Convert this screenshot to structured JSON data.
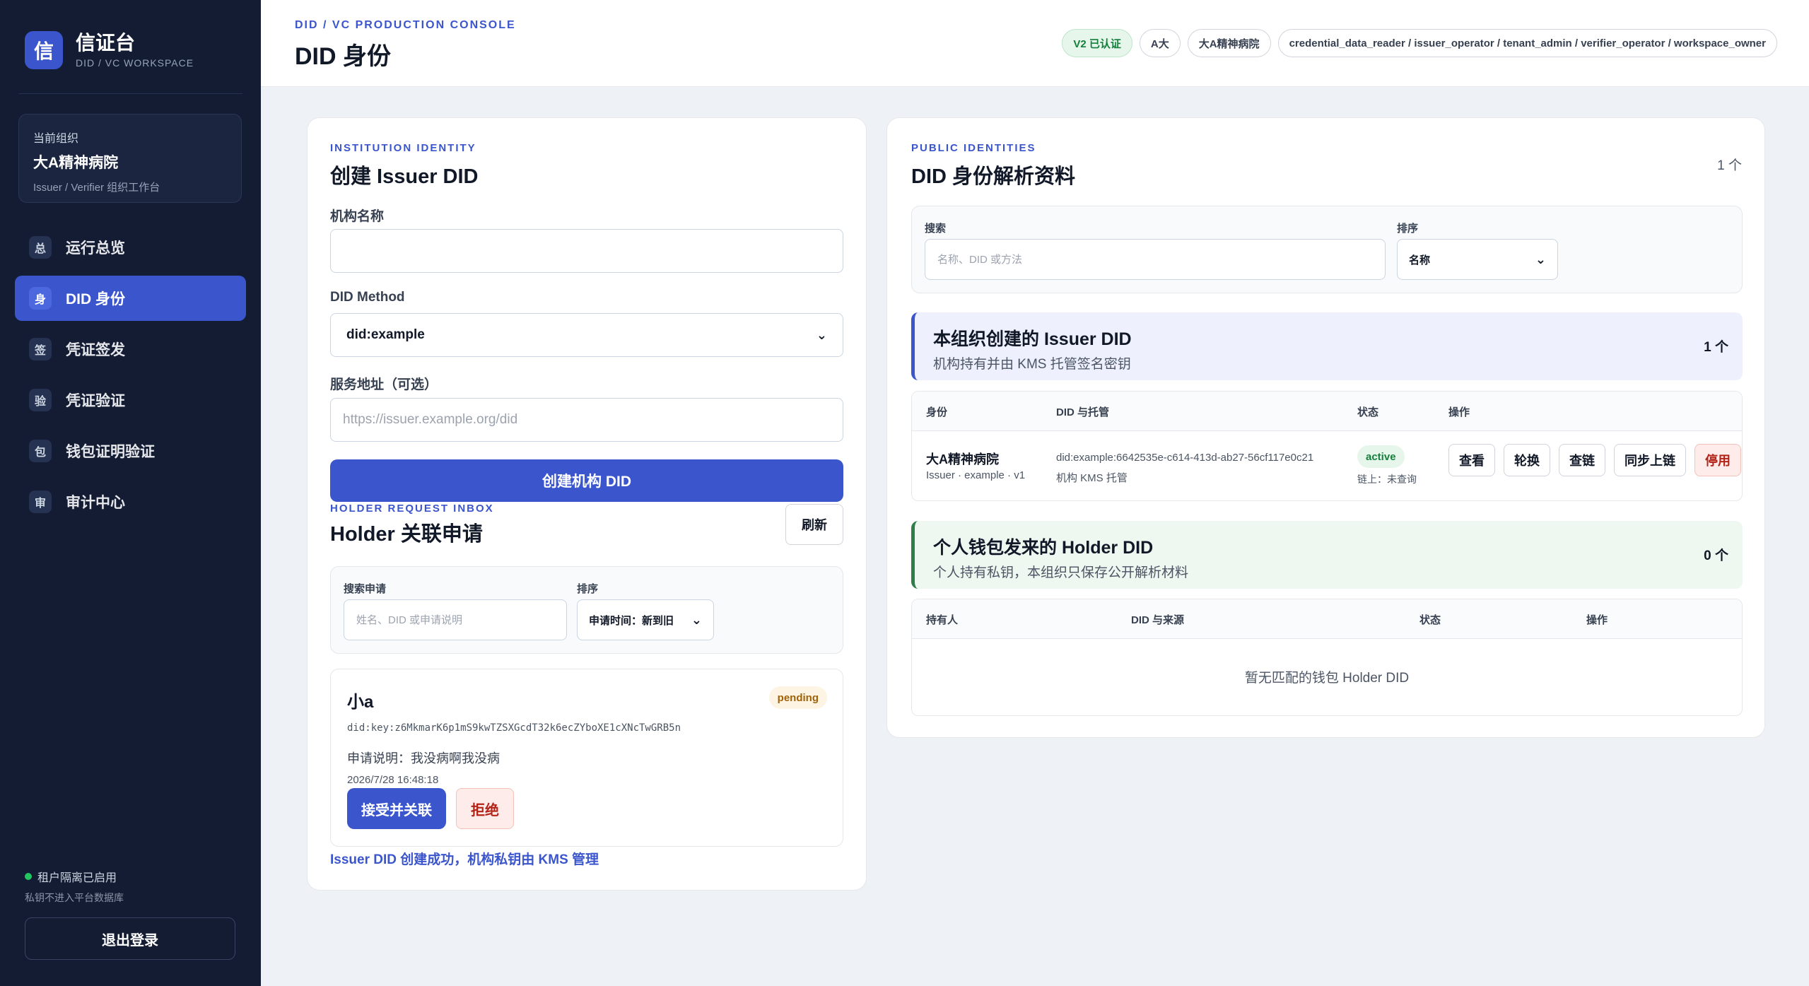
{
  "sidebar": {
    "logo_char": "信",
    "brand_name": "信证台",
    "brand_sub": "DID / VC WORKSPACE",
    "org_caption": "当前组织",
    "org_name": "大A精神病院",
    "org_role": "Issuer / Verifier 组织工作台",
    "nav": [
      {
        "badge": "总",
        "label": "运行总览",
        "active": false
      },
      {
        "badge": "身",
        "label": "DID 身份",
        "active": true
      },
      {
        "badge": "签",
        "label": "凭证签发",
        "active": false
      },
      {
        "badge": "验",
        "label": "凭证验证",
        "active": false
      },
      {
        "badge": "包",
        "label": "钱包证明验证",
        "active": false
      },
      {
        "badge": "审",
        "label": "审计中心",
        "active": false
      }
    ],
    "tenant_status": "租户隔离已启用",
    "tenant_note": "私钥不进入平台数据库",
    "logout": "退出登录"
  },
  "topbar": {
    "kicker": "DID / VC PRODUCTION CONSOLE",
    "title": "DID 身份",
    "chips": [
      "V2 已认证",
      "A大",
      "大A精神病院",
      "credential_data_reader / issuer_operator / tenant_admin / verifier_operator / workspace_owner"
    ]
  },
  "create": {
    "kicker": "INSTITUTION IDENTITY",
    "title": "创建 Issuer DID",
    "org_label": "机构名称",
    "org_value": "",
    "method_label": "DID Method",
    "method_value": "did:example",
    "service_label": "服务地址（可选）",
    "service_placeholder": "https://issuer.example.org/did",
    "submit": "创建机构 DID",
    "success_msg": "Issuer DID 创建成功，机构私钥由 KMS 管理"
  },
  "inbox": {
    "kicker": "HOLDER REQUEST INBOX",
    "title": "Holder 关联申请",
    "refresh": "刷新",
    "search_label": "搜索申请",
    "search_placeholder": "姓名、DID 或申请说明",
    "sort_label": "排序",
    "sort_value": "申请时间：新到旧",
    "request": {
      "name": "小a",
      "status": "pending",
      "did": "did:key:z6MkmarK6p1mS9kwTZSXGcdT32k6ecZYboXE1cXNcTwGRB5n",
      "note": "申请说明：我没病啊我没病",
      "time": "2026/7/28 16:48:18",
      "accept": "接受并关联",
      "reject": "拒绝"
    }
  },
  "public": {
    "kicker": "PUBLIC IDENTITIES",
    "title": "DID 身份解析资料",
    "count": "1 个",
    "search_label": "搜索",
    "search_placeholder": "名称、DID 或方法",
    "sort_label": "排序",
    "sort_value": "名称",
    "issuer_section": {
      "title": "本组织创建的 Issuer DID",
      "sub": "机构持有并由 KMS 托管签名密钥",
      "count": "1 个",
      "headers": [
        "身份",
        "DID 与托管",
        "状态",
        "操作"
      ],
      "row": {
        "name": "大A精神病院",
        "meta": "Issuer · example · v1",
        "did": "did:example:6642535e-c614-413d-ab27-56cf117e0c21",
        "custody": "机构 KMS 托管",
        "status": "active",
        "chain": "链上：未查询",
        "actions": [
          "查看",
          "轮换",
          "查链",
          "同步上链",
          "停用"
        ]
      }
    },
    "holder_section": {
      "title": "个人钱包发来的 Holder DID",
      "sub": "个人持有私钥，本组织只保存公开解析材料",
      "count": "0 个",
      "headers": [
        "持有人",
        "DID 与来源",
        "状态",
        "操作"
      ],
      "empty": "暂无匹配的钱包 Holder DID"
    }
  },
  "colors": {
    "accent": "#3b56cc",
    "sidebar": "#141c33",
    "success": "#15803d",
    "danger": "#b42318"
  }
}
